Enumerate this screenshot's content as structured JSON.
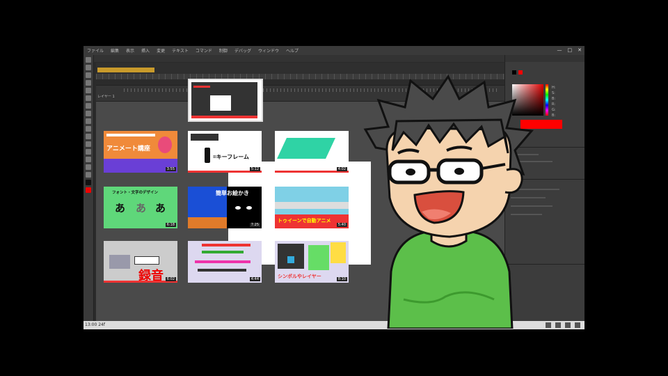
{
  "menu": [
    "ファイル",
    "編集",
    "表示",
    "挿入",
    "変更",
    "テキスト",
    "コマンド",
    "制御",
    "デバッグ",
    "ウィンドウ",
    "ヘルプ"
  ],
  "window_controls": [
    "—",
    "□",
    "✕"
  ],
  "timeline": {
    "layer_label": "レイヤー 1"
  },
  "statusbar": {
    "left": "13:00 24f"
  },
  "thumbnails": [
    {
      "title": "アニメート講座",
      "duration": "3:55"
    },
    {
      "title": "=キーフレーム",
      "duration": "5:12"
    },
    {
      "title": "",
      "duration": "4:02"
    },
    {
      "title": "フォント・文字のデザイン",
      "glyphs": [
        "あ",
        "あ",
        "あ"
      ],
      "duration": "6:18"
    },
    {
      "title": "簡単お絵かき",
      "duration": "7:25"
    },
    {
      "title": "トゥイーンで自動アニメ",
      "duration": "5:40"
    },
    {
      "title": "録音",
      "duration": "6:02"
    },
    {
      "title": "",
      "duration": "4:44"
    },
    {
      "title": "シンボルやレイヤー",
      "duration": "8:10"
    }
  ],
  "colors": {
    "accent_red": "#ff0000",
    "screen_bg": "#2b2b2b",
    "panel_bg": "#3c3c3c",
    "shirt_green": "#5cbf4a"
  },
  "icons": [
    "minimize-icon",
    "maximize-icon",
    "close-icon",
    "color-picker",
    "tool-icon"
  ]
}
